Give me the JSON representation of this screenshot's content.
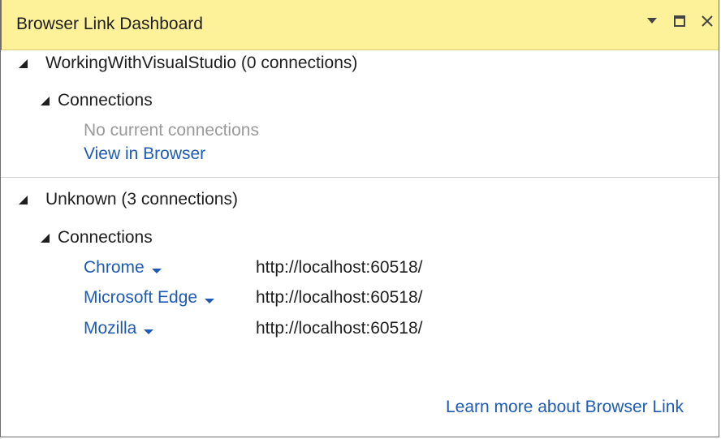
{
  "window": {
    "title": "Browser Link Dashboard",
    "buttons": {
      "dropdown": "▼",
      "maximize": "☐",
      "close": "✕"
    }
  },
  "projects": [
    {
      "header": "WorkingWithVisualStudio (0 connections)",
      "connections_label": "Connections",
      "empty_text": "No current connections",
      "view_link": "View in Browser"
    },
    {
      "header": "Unknown (3 connections)",
      "connections_label": "Connections",
      "connections": [
        {
          "browser": "Chrome",
          "url": "http://localhost:60518/"
        },
        {
          "browser": "Microsoft Edge",
          "url": "http://localhost:60518/"
        },
        {
          "browser": "Mozilla",
          "url": "http://localhost:60518/"
        }
      ]
    }
  ],
  "footer": {
    "learn_more": "Learn more about Browser Link"
  },
  "colors": {
    "title_bg": "#fdf29a",
    "link": "#1e5bb5",
    "muted": "#9a9a9a"
  }
}
